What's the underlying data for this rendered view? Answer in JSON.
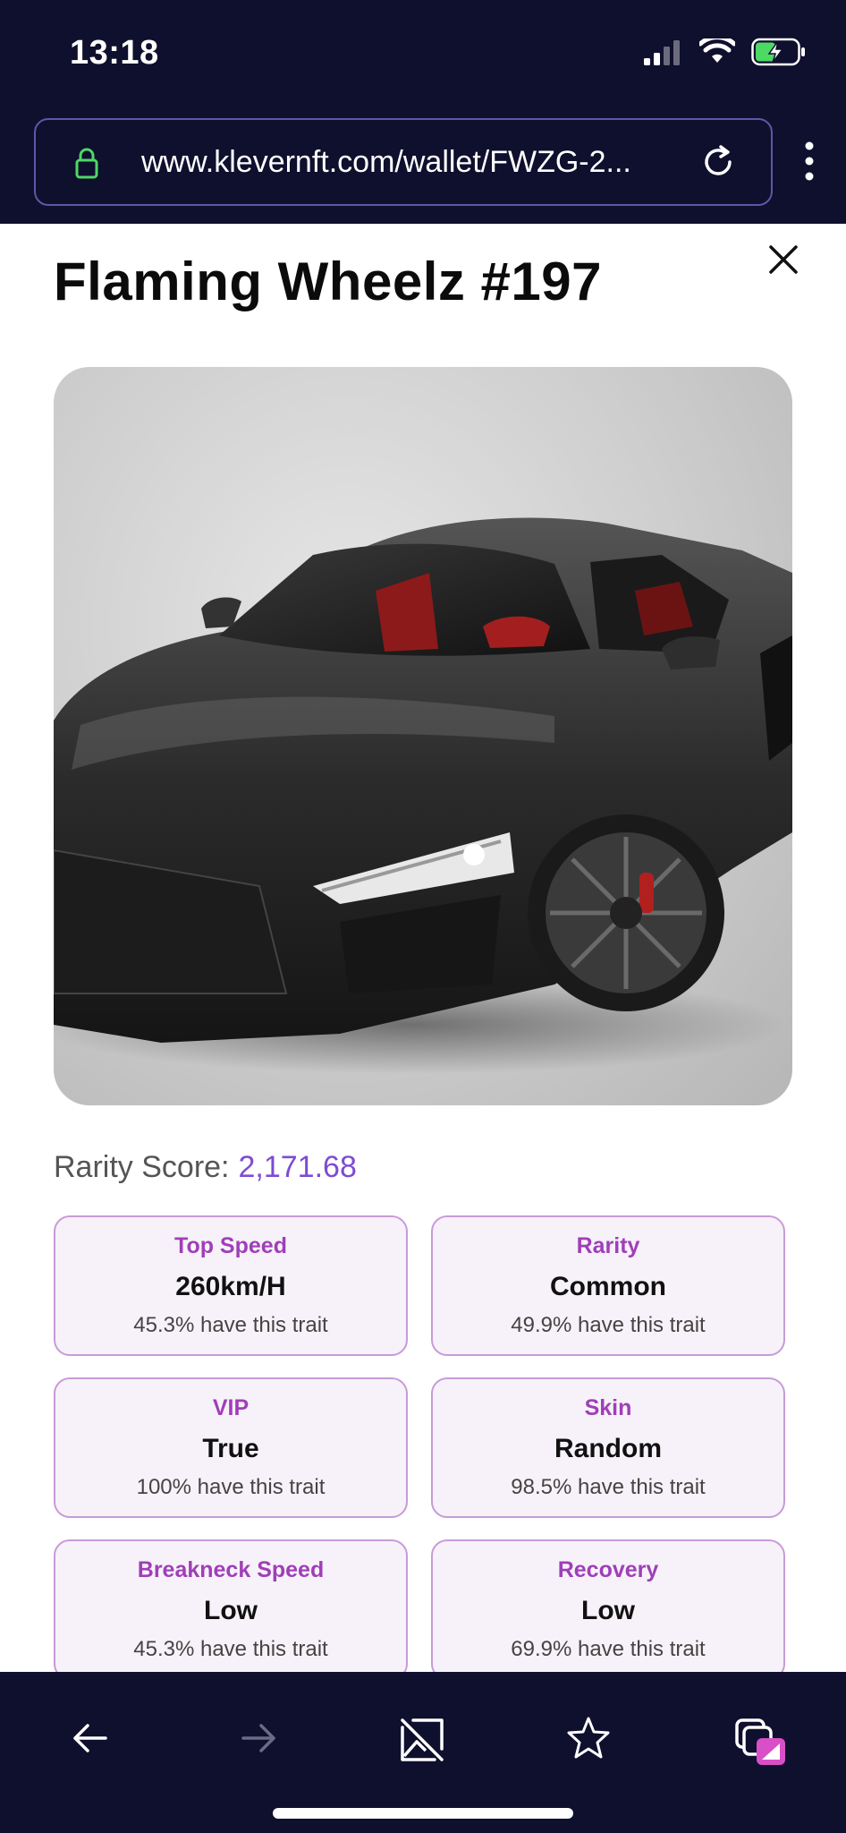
{
  "status": {
    "time": "13:18"
  },
  "browser": {
    "url": "www.klevernft.com/wallet/FWZG-2..."
  },
  "nft": {
    "title": "Flaming Wheelz #197",
    "rarity_label": "Rarity Score:",
    "rarity_value": "2,171.68"
  },
  "traits": [
    {
      "name": "Top Speed",
      "value": "260km/H",
      "pct": "45.3% have this trait"
    },
    {
      "name": "Rarity",
      "value": "Common",
      "pct": "49.9% have this trait"
    },
    {
      "name": "VIP",
      "value": "True",
      "pct": "100% have this trait"
    },
    {
      "name": "Skin",
      "value": "Random",
      "pct": "98.5% have this trait"
    },
    {
      "name": "Breakneck Speed",
      "value": "Low",
      "pct": "45.3% have this trait"
    },
    {
      "name": "Recovery",
      "value": "Low",
      "pct": "69.9% have this trait"
    }
  ],
  "colors": {
    "bar_bg": "#0f0f2e",
    "accent": "#7d4cd3",
    "trait_name": "#9f3fb8",
    "trait_border": "#c79bd8",
    "trait_bg": "#f7f2f9",
    "battery": "#4cd964"
  },
  "icons": {
    "status": [
      "signal-icon",
      "wifi-icon",
      "battery-charging-icon"
    ],
    "bottom_nav": [
      "back-arrow-icon",
      "forward-arrow-icon",
      "no-image-icon",
      "star-icon",
      "tabs-icon"
    ]
  }
}
